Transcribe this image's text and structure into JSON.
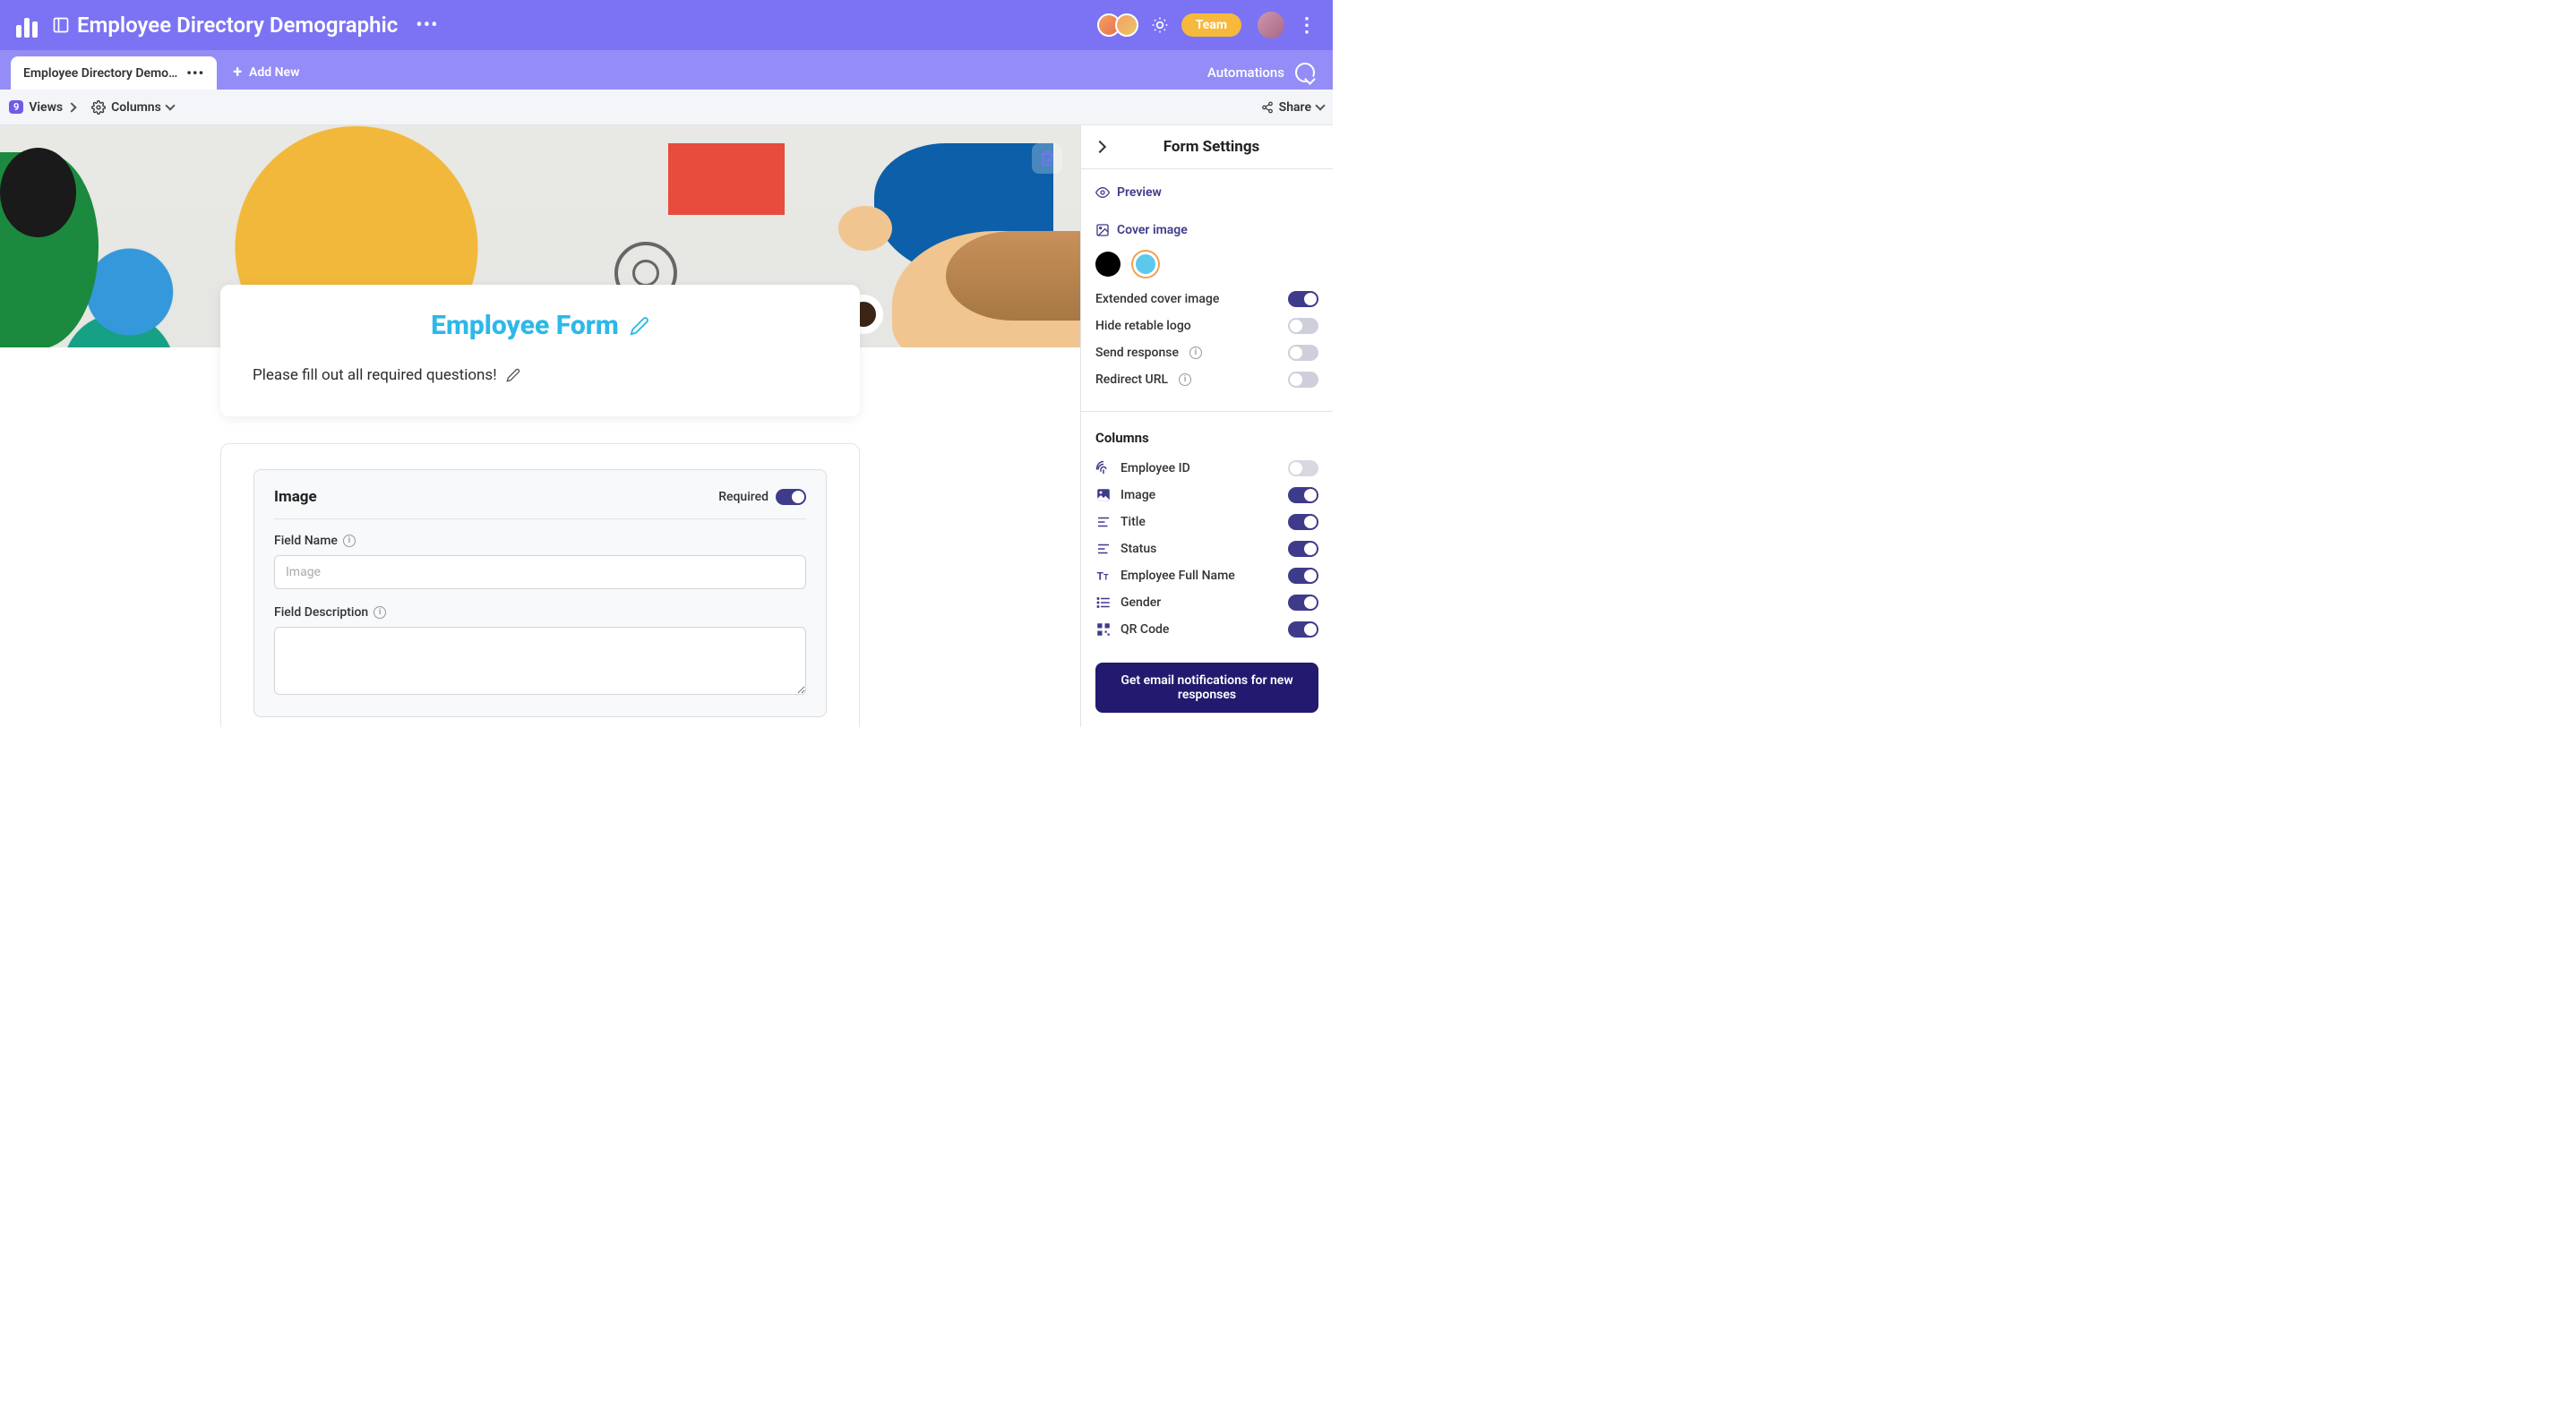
{
  "header": {
    "title": "Employee Directory Demographic",
    "team_label": "Team"
  },
  "subheader": {
    "tab_label": "Employee Directory Demo…",
    "add_new_label": "Add New",
    "automations_label": "Automations"
  },
  "toolbar": {
    "views_count": "9",
    "views_label": "Views",
    "columns_label": "Columns",
    "share_label": "Share"
  },
  "form": {
    "title": "Employee Form",
    "description": "Please fill out all required questions!",
    "field": {
      "section_title": "Image",
      "required_label": "Required",
      "name_label": "Field Name",
      "name_placeholder": "Image",
      "description_label": "Field Description"
    }
  },
  "panel": {
    "title": "Form Settings",
    "preview_label": "Preview",
    "cover_image_label": "Cover image",
    "options": {
      "extended_cover": "Extended cover image",
      "hide_logo": "Hide retable logo",
      "send_response": "Send response",
      "redirect_url": "Redirect URL"
    },
    "toggles": {
      "extended_cover": true,
      "hide_logo": false,
      "send_response": false,
      "redirect_url": false
    },
    "columns_title": "Columns",
    "columns": [
      {
        "label": "Employee ID",
        "icon": "fingerprint",
        "on": false
      },
      {
        "label": "Image",
        "icon": "image",
        "on": true
      },
      {
        "label": "Title",
        "icon": "text",
        "on": true
      },
      {
        "label": "Status",
        "icon": "text",
        "on": true
      },
      {
        "label": "Employee Full Name",
        "icon": "tt",
        "on": true
      },
      {
        "label": "Gender",
        "icon": "list",
        "on": true
      },
      {
        "label": "QR Code",
        "icon": "qr",
        "on": true
      }
    ],
    "cta": "Get email notifications for new responses"
  }
}
